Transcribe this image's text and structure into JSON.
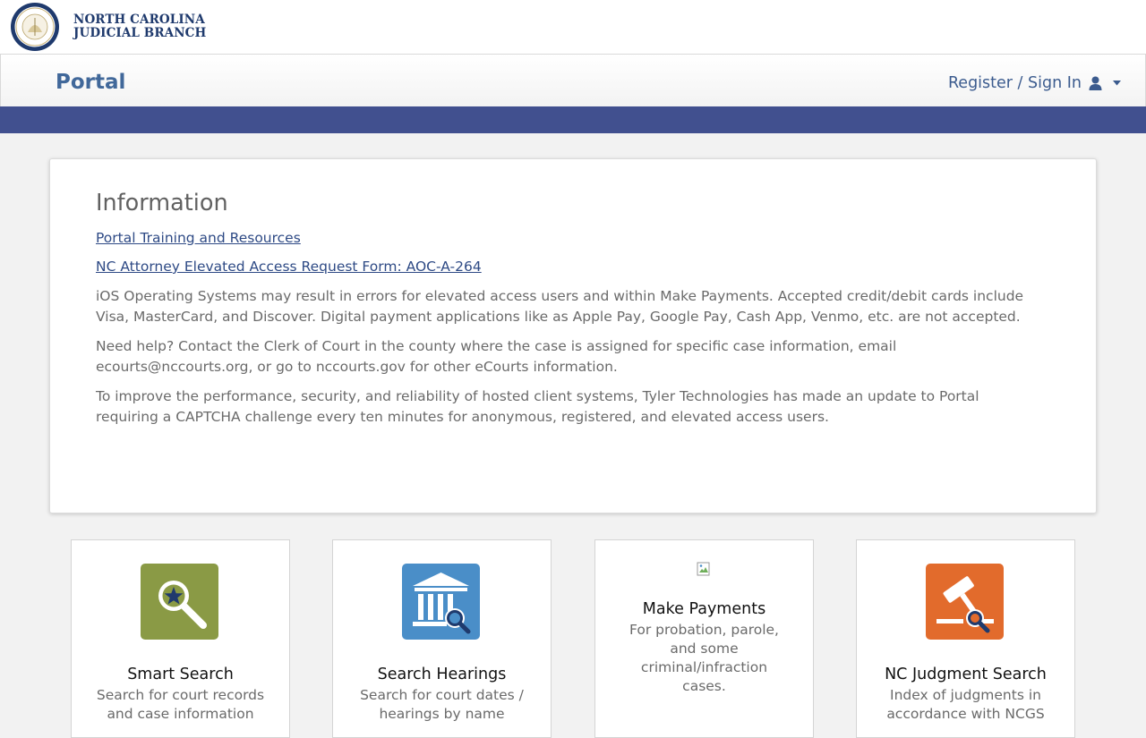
{
  "brand": {
    "line1": "NORTH CAROLINA",
    "line2": "JUDICIAL BRANCH"
  },
  "nav": {
    "title": "Portal",
    "signin_label": "Register / Sign In"
  },
  "info": {
    "heading": "Information",
    "links": [
      "Portal Training and Resources",
      "NC Attorney Elevated Access Request Form: AOC-A-264"
    ],
    "paragraphs": [
      "iOS Operating Systems may result in errors for elevated access users and within Make Payments. Accepted credit/debit cards include Visa, MasterCard, and Discover. Digital payment applications like as Apple Pay, Google Pay, Cash App, Venmo, etc. are not accepted.",
      "Need help? Contact the Clerk of Court in the county where the case is assigned for specific case information, email ecourts@nccourts.org, or go to nccourts.gov for other eCourts information.",
      "To improve the performance, security, and reliability of hosted client systems, Tyler Technologies has made an update to Portal requiring a CAPTCHA challenge every ten minutes for anonymous, registered, and elevated access users."
    ]
  },
  "cards": [
    {
      "title": "Smart Search",
      "desc": "Search for court records and case information",
      "icon": "magnifier-star-icon",
      "color": "#8a9a45"
    },
    {
      "title": "Search Hearings",
      "desc": "Search for court dates / hearings by name",
      "icon": "courthouse-search-icon",
      "color": "#4a8ec8"
    },
    {
      "title": "Make Payments",
      "desc": "For probation, parole, and some criminal/infraction cases.",
      "icon": "broken-image-icon"
    },
    {
      "title": "NC Judgment Search",
      "desc": "Index of judgments in accordance with NCGS",
      "icon": "gavel-search-icon",
      "color": "#e26b2c"
    }
  ],
  "colors": {
    "accent_band": "#41508f",
    "title_blue": "#41689a",
    "link": "#2e4a85"
  }
}
